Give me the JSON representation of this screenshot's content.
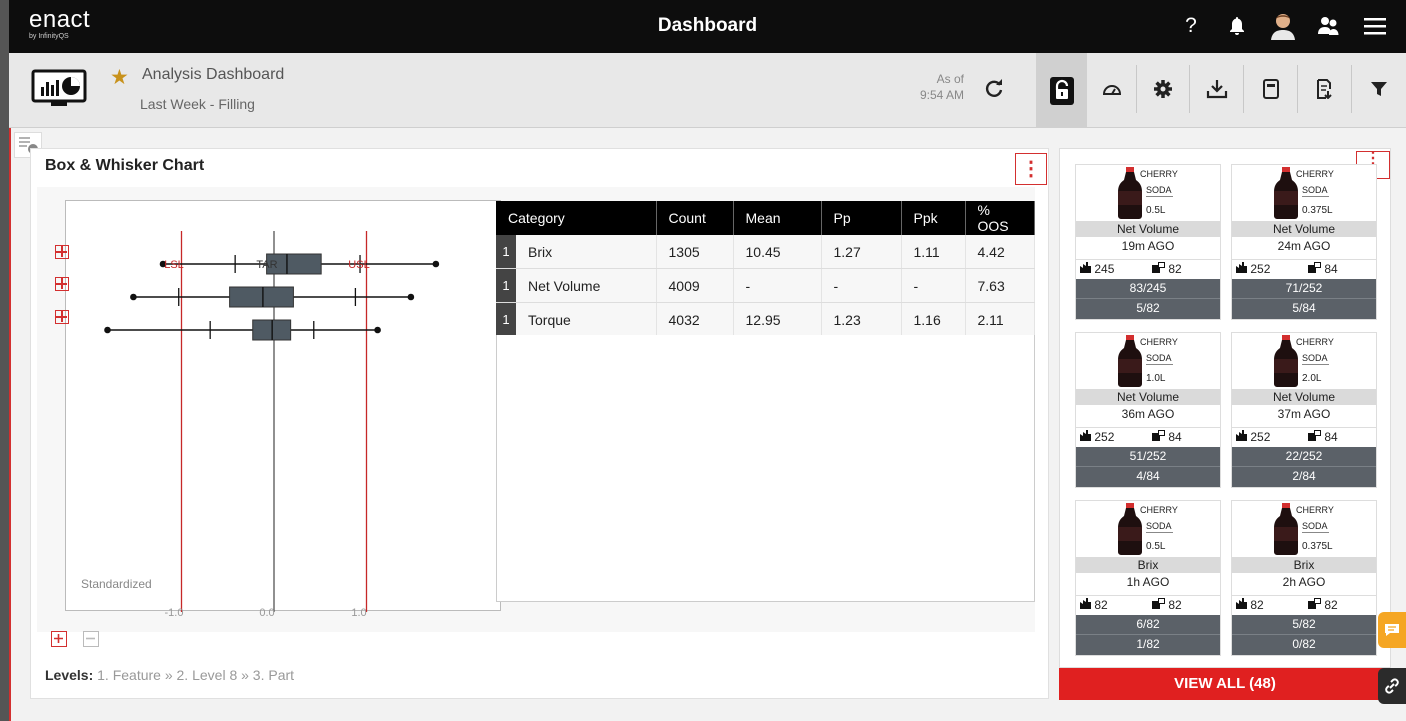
{
  "app": {
    "logo": "enact",
    "logo_sub": "by InfinityQS",
    "title": "Dashboard",
    "icons": [
      "help-icon",
      "bell-icon",
      "user-avatar",
      "people-icon",
      "hamburger-menu-icon"
    ]
  },
  "subheader": {
    "title": "Analysis Dashboard",
    "subtitle": "Last Week - Filling",
    "as_of_label": "As of",
    "as_of_time": "9:54 AM",
    "tools": [
      "refresh-icon",
      "lock-icon",
      "gauge-icon",
      "settings-icon",
      "download-icon",
      "save-icon",
      "export-icon",
      "filter-icon"
    ]
  },
  "panel": {
    "title": "Box & Whisker Chart",
    "standardized_label": "Standardized",
    "ref_lines": {
      "lsl": "LSL",
      "tar": "TAR",
      "usl": "USL"
    },
    "axis_ticks": [
      "-1.0",
      "0.0",
      "1.0"
    ],
    "levels_label": "Levels:",
    "levels_path": "1. Feature » 2. Level 8 » 3. Part"
  },
  "chart_data": {
    "type": "box",
    "xlim": [
      -1.45,
      1.6
    ],
    "reference_lines": [
      {
        "name": "LSL",
        "x": -1.0,
        "color": "#c62828"
      },
      {
        "name": "TAR",
        "x": 0.0,
        "color": "#555555"
      },
      {
        "name": "USL",
        "x": 1.0,
        "color": "#c62828"
      }
    ],
    "x_ticks": [
      "-1.0",
      "0.0",
      "1.0"
    ],
    "boxes": [
      {
        "category": "Brix",
        "min": -1.2,
        "lower_whisker_tick": -0.42,
        "q1": -0.08,
        "median": 0.14,
        "q3": 0.51,
        "upper_whisker_tick": 0.93,
        "max": 1.75
      },
      {
        "category": "Net Volume",
        "min": -1.52,
        "lower_whisker_tick": -1.03,
        "q1": -0.48,
        "median": -0.12,
        "q3": 0.21,
        "upper_whisker_tick": 0.88,
        "max": 1.48
      },
      {
        "category": "Torque",
        "min": -1.8,
        "lower_whisker_tick": -0.69,
        "q1": -0.23,
        "median": -0.02,
        "q3": 0.18,
        "upper_whisker_tick": 0.43,
        "max": 1.12
      }
    ]
  },
  "table": {
    "headers": [
      "Category",
      "Count",
      "Mean",
      "Pp",
      "Ppk",
      "% OOS"
    ],
    "rows": [
      {
        "num": "1",
        "category": "Brix",
        "count": "1305",
        "mean": "10.45",
        "pp": "1.27",
        "ppk": "1.11",
        "oos": "4.42"
      },
      {
        "num": "1",
        "category": "Net Volume",
        "count": "4009",
        "mean": "-",
        "pp": "-",
        "ppk": "-",
        "oos": "7.63"
      },
      {
        "num": "1",
        "category": "Torque",
        "count": "4032",
        "mean": "12.95",
        "pp": "1.23",
        "ppk": "1.16",
        "oos": "2.11"
      }
    ]
  },
  "cards": [
    {
      "line1": "CHERRY",
      "line2": "SODA",
      "size": "0.5L",
      "metric": "Net Volume",
      "ago": "19m AGO",
      "c1": "245",
      "c2": "82",
      "r1": "83/245",
      "r2": "5/82"
    },
    {
      "line1": "CHERRY",
      "line2": "SODA",
      "size": "0.375L",
      "metric": "Net Volume",
      "ago": "24m AGO",
      "c1": "252",
      "c2": "84",
      "r1": "71/252",
      "r2": "5/84"
    },
    {
      "line1": "CHERRY",
      "line2": "SODA",
      "size": "1.0L",
      "metric": "Net Volume",
      "ago": "36m AGO",
      "c1": "252",
      "c2": "84",
      "r1": "51/252",
      "r2": "4/84"
    },
    {
      "line1": "CHERRY",
      "line2": "SODA",
      "size": "2.0L",
      "metric": "Net Volume",
      "ago": "37m AGO",
      "c1": "252",
      "c2": "84",
      "r1": "22/252",
      "r2": "2/84"
    },
    {
      "line1": "CHERRY",
      "line2": "SODA",
      "size": "0.5L",
      "metric": "Brix",
      "ago": "1h AGO",
      "c1": "82",
      "c2": "82",
      "r1": "6/82",
      "r2": "1/82"
    },
    {
      "line1": "CHERRY",
      "line2": "SODA",
      "size": "0.375L",
      "metric": "Brix",
      "ago": "2h AGO",
      "c1": "82",
      "c2": "82",
      "r1": "5/82",
      "r2": "0/82"
    }
  ],
  "view_all": "VIEW ALL (48)",
  "colors": {
    "accent_red": "#d32f2f",
    "star": "#c8921c",
    "topbar": "#0d0d0d",
    "card_dark": "#5b6168"
  }
}
